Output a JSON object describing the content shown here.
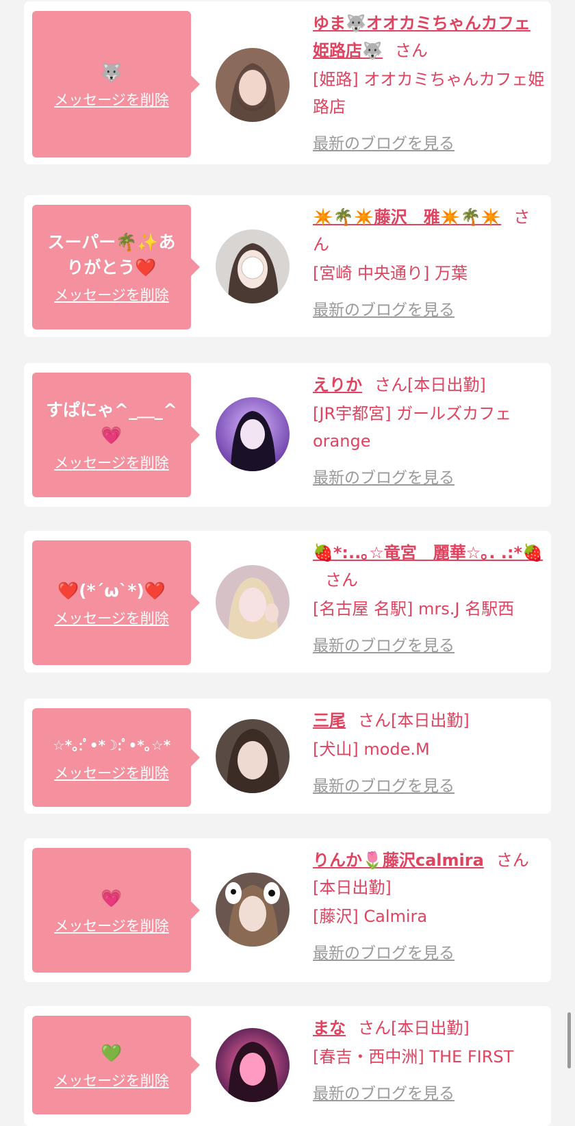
{
  "colors": {
    "accent": "#e0435f",
    "bubble": "#f5919e",
    "link_gray": "#9a9a9a"
  },
  "delete_label": "メッセージを削除",
  "blog_label": "最新のブログを見る",
  "san_label": "さん",
  "cards": [
    {
      "message": "🐺",
      "name": "ゆま🐺オオカミちゃんカフェ姫路店🐺",
      "suffix": "",
      "shop": "[姫路] オオカミちゃんカフェ姫路店"
    },
    {
      "message": "スーパー🌴✨ありがとう❤️",
      "name": "✴️🌴✴️藤沢　雅✴️🌴✴️",
      "suffix": "",
      "shop": "[宮崎 中央通り] 万葉"
    },
    {
      "message": "すぱにゃ^_＿_^💗",
      "name": "えりか",
      "suffix": "[本日出勤]",
      "shop": "[JR宇都宮] ガールズカフェ orange"
    },
    {
      "message": "❤️(*´ω`*)❤️",
      "name": "🍓*:..｡☆竜宮　麗華☆｡. .:*🍓",
      "suffix": "",
      "shop": "[名古屋 名駅] mrs.J 名駅西"
    },
    {
      "message": "☆*｡:ﾟ•*☽:ﾟ•*｡☆*",
      "name": "三尾",
      "suffix": "[本日出勤]",
      "shop": "[犬山] mode.M"
    },
    {
      "message": "💗",
      "name": "りんか🌷藤沢calmira",
      "suffix": "[本日出勤]",
      "shop": "[藤沢] Calmira"
    },
    {
      "message": "💚",
      "name": "まな",
      "suffix": "[本日出勤]",
      "shop": "[春吉・西中洲] THE FIRST"
    }
  ]
}
